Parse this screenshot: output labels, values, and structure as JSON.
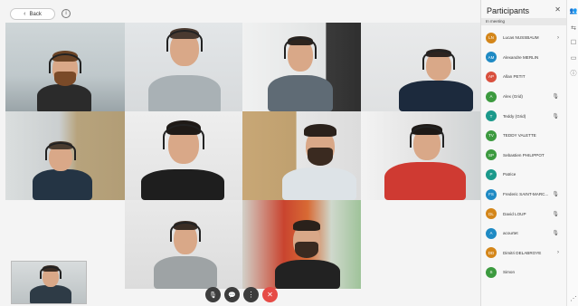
{
  "topbar": {
    "back_label": "Back",
    "info_icon": "info-icon"
  },
  "panel": {
    "title": "Participants",
    "section": "In meeting",
    "participants": [
      {
        "initials": "LN",
        "name": "Lucas NUSSBAUM",
        "color": "#d4861a",
        "mic": "›"
      },
      {
        "initials": "AM",
        "name": "Alexandre MERLIN",
        "color": "#1f8ac4",
        "mic": ""
      },
      {
        "initials": "AP",
        "name": "Allan PETIT",
        "color": "#d9503e",
        "mic": ""
      },
      {
        "initials": "A",
        "name": "Alex (Grid)",
        "color": "#3c9a3f",
        "mic": "🎙"
      },
      {
        "initials": "T",
        "name": "Teddy (Grid)",
        "color": "#1b998b",
        "mic": "🎙"
      },
      {
        "initials": "TV",
        "name": "TEDDY VALETTE",
        "color": "#3c9a3f",
        "mic": ""
      },
      {
        "initials": "SP",
        "name": "Sebastien PHILIPPOT",
        "color": "#3c9a3f",
        "mic": ""
      },
      {
        "initials": "P",
        "name": "Patrice",
        "color": "#1b998b",
        "mic": ""
      },
      {
        "initials": "FS",
        "name": "Frederic SAINT-MARC...",
        "color": "#1f8ac4",
        "mic": "🎙"
      },
      {
        "initials": "DL",
        "name": "David LOUP",
        "color": "#d4861a",
        "mic": "🎙"
      },
      {
        "initials": "A",
        "name": "acourtet",
        "color": "#1f8ac4",
        "mic": "🎙"
      },
      {
        "initials": "DD",
        "name": "Dimitri DELABROYE",
        "color": "#d4861a",
        "mic": "›"
      },
      {
        "initials": "S",
        "name": "Simon",
        "color": "#3c9a3f",
        "mic": ""
      }
    ]
  },
  "controls": {
    "mic": "🎙",
    "chat": "💬",
    "more": "⋮",
    "hangup": "✕"
  },
  "rail": {
    "people": "👥",
    "options": "⇆",
    "chat": "☐",
    "present": "▭",
    "info": "ⓘ",
    "signal": "⋰"
  }
}
